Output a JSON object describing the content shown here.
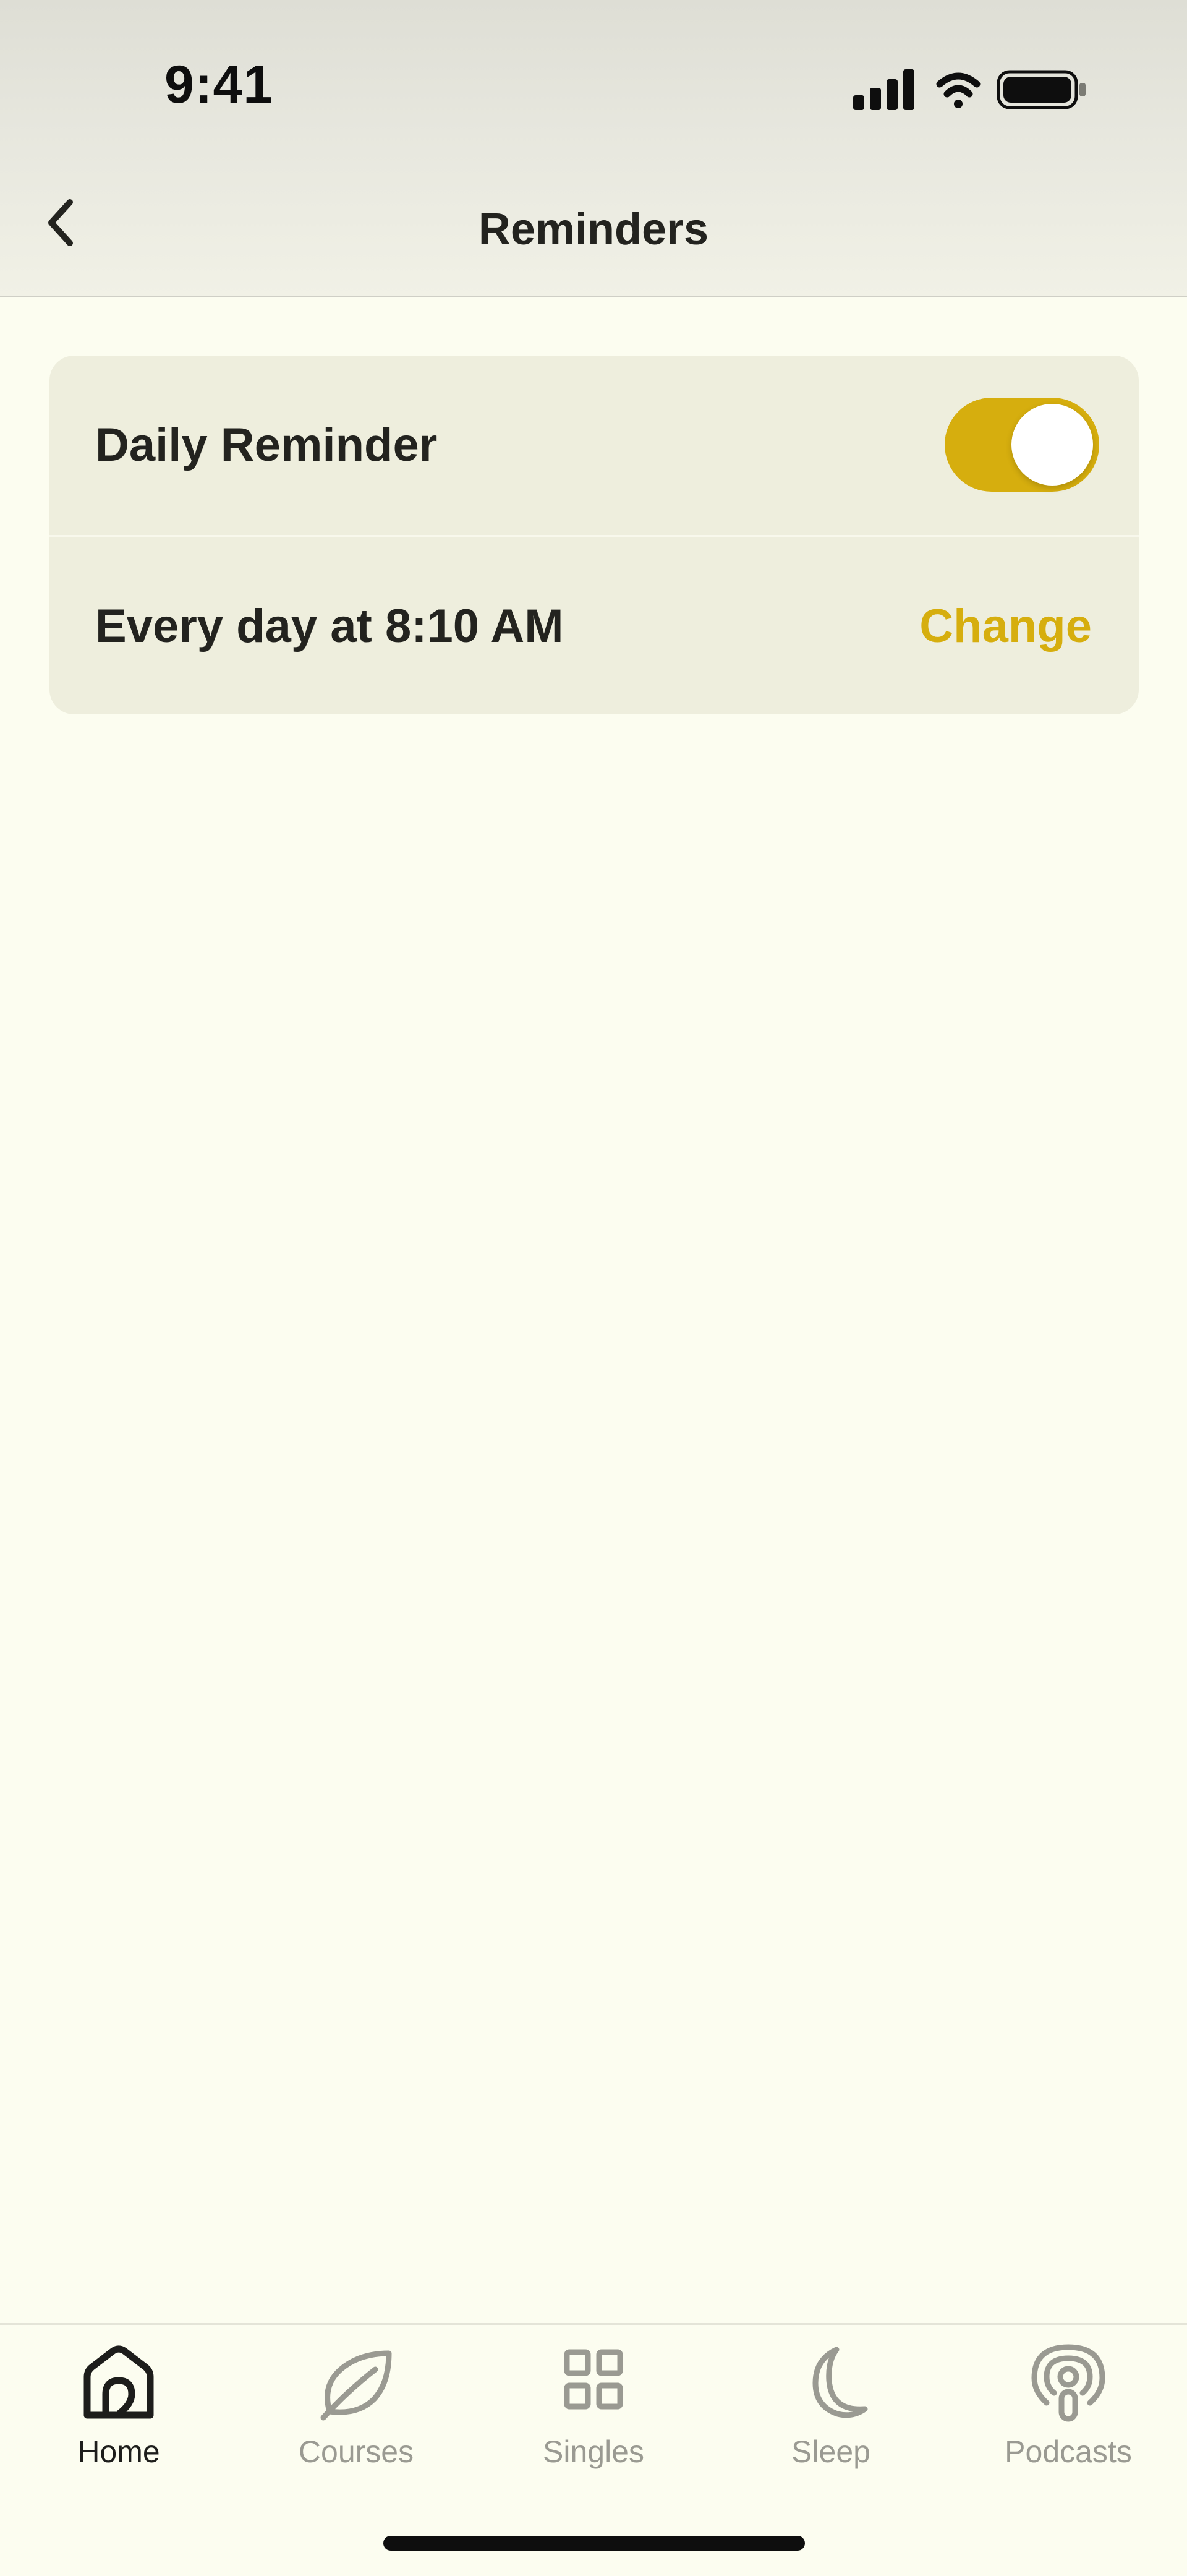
{
  "status_bar": {
    "time": "9:41",
    "icons": [
      "cellular-signal-icon",
      "wifi-icon",
      "battery-icon"
    ]
  },
  "nav": {
    "back_icon": "chevron-left-icon",
    "title": "Reminders"
  },
  "reminder_card": {
    "daily_reminder_label": "Daily Reminder",
    "daily_reminder_enabled": true,
    "schedule_text": "Every day at 8:10 AM",
    "change_label": "Change"
  },
  "tab_bar": {
    "tabs": [
      {
        "label": "Home",
        "icon": "home-icon",
        "active": true
      },
      {
        "label": "Courses",
        "icon": "leaf-icon",
        "active": false
      },
      {
        "label": "Singles",
        "icon": "grid-icon",
        "active": false
      },
      {
        "label": "Sleep",
        "icon": "moon-icon",
        "active": false
      },
      {
        "label": "Podcasts",
        "icon": "podcast-icon",
        "active": false
      }
    ]
  },
  "colors": {
    "accent": "#d6ae0e",
    "background": "#fcfdf0",
    "card": "#eeeedd",
    "text": "#1d1d1b",
    "inactive_tab": "#9a9a92"
  }
}
